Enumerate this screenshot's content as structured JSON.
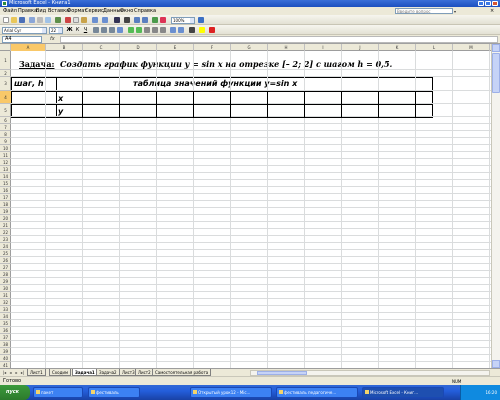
{
  "titlebar": {
    "title": "Microsoft Excel - Книга1"
  },
  "menubar": {
    "items": [
      "Файл",
      "Правка",
      "Вид",
      "Вставка",
      "Формат",
      "Сервис",
      "Данные",
      "Окно",
      "Справка"
    ],
    "help_placeholder": "Введите вопрос"
  },
  "toolbar": {
    "zoom": "100%"
  },
  "format_toolbar": {
    "font": "Arial Cyr",
    "size": "22",
    "bold": "Ж",
    "italic": "К",
    "underline": "Ч"
  },
  "formulabar": {
    "cell_ref": "A4",
    "fx": "fx"
  },
  "grid": {
    "columns": [
      "A",
      "B",
      "C",
      "D",
      "E",
      "F",
      "G",
      "H",
      "I",
      "J",
      "K",
      "L",
      "M"
    ],
    "selected_column": "A",
    "rows": [
      "1",
      "2",
      "3",
      "4",
      "5",
      "6",
      "7",
      "8",
      "9",
      "10",
      "11",
      "12",
      "13",
      "14",
      "15",
      "16",
      "17",
      "18",
      "19",
      "20",
      "21",
      "22",
      "23",
      "24",
      "25",
      "26",
      "27",
      "28",
      "29",
      "30",
      "31",
      "32",
      "33",
      "34",
      "35",
      "36",
      "37",
      "38",
      "39",
      "40",
      "41",
      "42"
    ],
    "selected_row": "4"
  },
  "sheet": {
    "task_label": "Задача:",
    "task_text": "Создать график функции y = sin x на отрезке [– 2; 2] с шагом h = 0,5.",
    "table_head_h": "шаг, h",
    "table_head_main": "таблица значений функции y=sin x",
    "row_x": "x",
    "row_y": "y"
  },
  "tabs": [
    "Лист1",
    "Сходим",
    "Задача1",
    "Задача2",
    "Лист3",
    "Лист2",
    "Самостоятельная работа"
  ],
  "active_tab": "Задача1",
  "status": {
    "text": "Готово",
    "num": "NUM"
  },
  "taskbar": {
    "start": "пуск",
    "buttons": [
      "пакет",
      "фестиваль",
      "Открытый урок12 - Mic...",
      "фестиваль педагогиче...",
      "Microsoft Excel - Книг..."
    ],
    "active_button": "Microsoft Excel - Книг...",
    "clock": "16:20"
  }
}
